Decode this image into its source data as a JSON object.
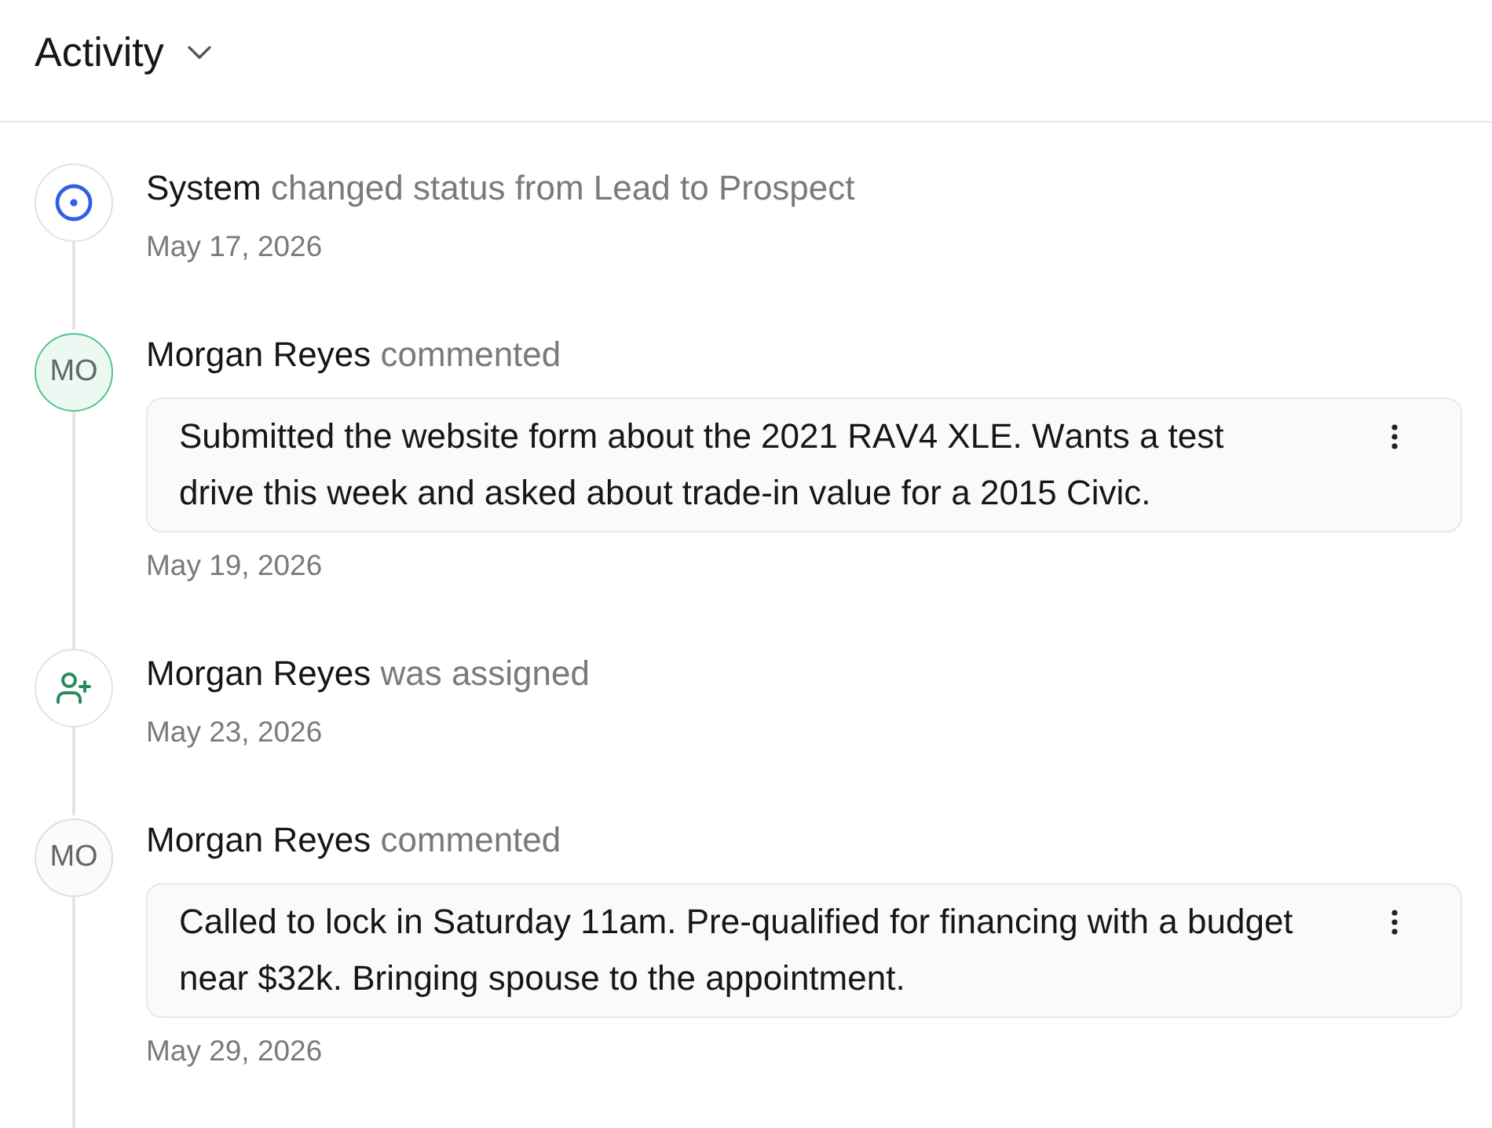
{
  "header": {
    "title": "Activity"
  },
  "events": [
    {
      "kind": "status",
      "actor": "System",
      "action": "changed status from Lead to Prospect",
      "date": "May 17, 2026"
    },
    {
      "kind": "comment",
      "avatar": {
        "initials": "MO",
        "color": "#52c48c"
      },
      "actor": "Morgan Reyes",
      "action": "commented",
      "comment": "Submitted the website form about the 2021 RAV4 XLE. Wants a test drive this week and asked about trade-in value for a 2015 Civic.",
      "date": "May 19, 2026"
    },
    {
      "kind": "assignment",
      "actor": "Morgan Reyes",
      "action": "was assigned",
      "date": "May 23, 2026"
    },
    {
      "kind": "comment",
      "avatar": {
        "initials": "MO",
        "color": "#dedede"
      },
      "actor": "Morgan Reyes",
      "action": "commented",
      "comment": "Called to lock in Saturday 11am. Pre-qualified for financing with a budget near $32k. Bringing spouse to the appointment.",
      "date": "May 29, 2026"
    }
  ]
}
